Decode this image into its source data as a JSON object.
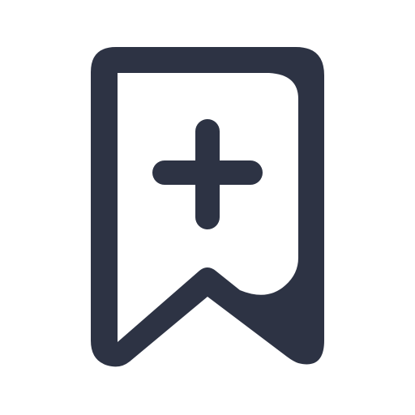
{
  "icon": {
    "name": "bookmark-add-icon",
    "color": "#2d3344",
    "background": "#ffffff"
  }
}
